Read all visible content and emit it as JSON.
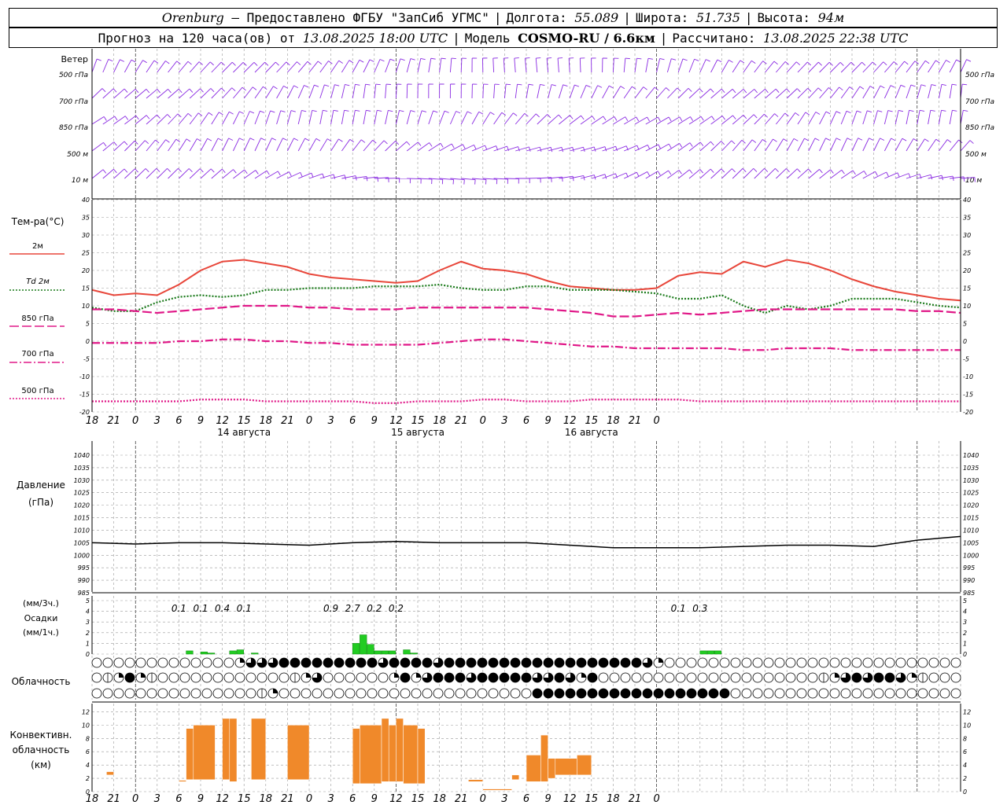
{
  "header": {
    "city": "Orenburg",
    "provider": "— Предоставлено ФГБУ \"ЗапСиб УГМС\"",
    "lon_label": "Долгота:",
    "lon_value": "55.089",
    "lat_label": "Широта:",
    "lat_value": "51.735",
    "alt_label": "Высота:",
    "alt_value": "94м",
    "forecast_label": "Прогноз на 120 часа(ов) от",
    "forecast_time": "13.08.2025 18:00 UTC",
    "model_label": "Модель",
    "model_value": "COSMO-RU / 6.6км",
    "calc_label": "Рассчитано:",
    "calc_time": "13.08.2025 22:38 UTC"
  },
  "labels": {
    "wind": "Ветер",
    "wind_levels": [
      "500 гПа",
      "700 гПа",
      "850 гПа",
      "500 м",
      "10  м"
    ],
    "temp": "Тем-ра(°C)",
    "temp_2m": "2м",
    "td_2m": "Td  2м",
    "t850": "850 гПа",
    "t700": "700 гПа",
    "t500": "500 гПа",
    "pressure": [
      "Давление",
      "(гПа)"
    ],
    "precip": [
      "(мм/3ч.)",
      "Осадки",
      "(мм/1ч.)"
    ],
    "clouds": "Облачность",
    "conv": [
      "Конвективн.",
      "облачность",
      "(км)"
    ]
  },
  "colors": {
    "wind": "#8a2be2",
    "t2m": "#e8463a",
    "td2m": "#1a7a1a",
    "t850": "#e01888",
    "t700": "#e01888",
    "t500": "#e01888",
    "pressure": "#000000",
    "precip": "#22cc22",
    "conv": "#f0892a",
    "grid": "#999999"
  },
  "chart_data": [
    {
      "type": "line",
      "title": "Тем-ра(°C)",
      "x_ticks": [
        "18",
        "21",
        "0",
        "3",
        "6",
        "9",
        "12",
        "15",
        "18",
        "21",
        "0",
        "3",
        "6",
        "9",
        "12",
        "15",
        "18",
        "21",
        "0",
        "3",
        "6",
        "9",
        "12",
        "15",
        "18",
        "21",
        "0"
      ],
      "date_labels": [
        "14 августа",
        "15 августа",
        "16 августа"
      ],
      "ylim": [
        -20,
        40
      ],
      "yticks": [
        -20,
        -15,
        -10,
        -5,
        0,
        5,
        10,
        15,
        20,
        25,
        30,
        35,
        40
      ],
      "x_hours": [
        0,
        3,
        6,
        9,
        12,
        15,
        18,
        21,
        24,
        27,
        30,
        33,
        36,
        39,
        42,
        45,
        48,
        51,
        54,
        57,
        60,
        63,
        66,
        69,
        72,
        75,
        78,
        81
      ],
      "series": [
        {
          "name": "2м",
          "style": "solid",
          "values": [
            14.5,
            13,
            13.5,
            13,
            16,
            20,
            22.5,
            23,
            22,
            21,
            19,
            18,
            17.5,
            17,
            16.5,
            17,
            20,
            22.5,
            20.5,
            20,
            19,
            17,
            15.5,
            15,
            14.5,
            14.5,
            15,
            18.5
          ]
        },
        {
          "name": "Td 2м",
          "style": "dotted",
          "values": [
            9.5,
            8.5,
            8.5,
            11,
            12.5,
            13,
            12.5,
            13,
            14.5,
            14.5,
            15,
            15,
            15,
            15.5,
            15.5,
            15.5,
            16,
            15,
            14.5,
            14.5,
            15.5,
            15.5,
            14.5,
            14.5,
            14.5,
            14,
            13.5,
            12
          ]
        },
        {
          "name": "850 гПа",
          "style": "dashed",
          "values": [
            9,
            9,
            8.5,
            8,
            8.5,
            9,
            9.5,
            10,
            10,
            10,
            9.5,
            9.5,
            9,
            9,
            9,
            9.5,
            9.5,
            9.5,
            9.5,
            9.5,
            9.5,
            9,
            8.5,
            8,
            7,
            7,
            7.5,
            8
          ]
        },
        {
          "name": "700 гПа",
          "style": "dashdot",
          "values": [
            -0.5,
            -0.5,
            -0.5,
            -0.5,
            0,
            0,
            0.5,
            0.5,
            0,
            0,
            -0.5,
            -0.5,
            -1,
            -1,
            -1,
            -1,
            -0.5,
            0,
            0.5,
            0.5,
            0,
            -0.5,
            -1,
            -1.5,
            -1.5,
            -2,
            -2,
            -2
          ]
        },
        {
          "name": "500 гПа",
          "style": "dotted",
          "values": [
            -17,
            -17,
            -17,
            -17,
            -17,
            -16.5,
            -16.5,
            -16.5,
            -17,
            -17,
            -17,
            -17,
            -17,
            -17.5,
            -17.5,
            -17,
            -17,
            -17,
            -16.5,
            -16.5,
            -17,
            -17,
            -17,
            -16.5,
            -16.5,
            -16.5,
            -16.5,
            -16.5
          ]
        }
      ],
      "series_tail": {
        "x_hours": [
          84,
          87,
          90,
          93,
          96,
          99,
          102,
          105,
          108,
          111,
          114,
          117,
          120
        ],
        "2м": [
          19.5,
          19,
          22.5,
          21,
          23,
          22,
          20,
          17.5,
          15.5,
          14,
          13,
          12,
          11.5
        ],
        "Td 2м": [
          12,
          13,
          10,
          8,
          10,
          9,
          10,
          12,
          12,
          12,
          11,
          10,
          9.5
        ],
        "850 гПа": [
          7.5,
          8,
          8.5,
          9,
          9,
          9,
          9,
          9,
          9,
          9,
          8.5,
          8.5,
          8
        ],
        "700 гПа": [
          -2,
          -2,
          -2.5,
          -2.5,
          -2,
          -2,
          -2,
          -2.5,
          -2.5,
          -2.5,
          -2.5,
          -2.5,
          -2.5
        ],
        "500 гПа": [
          -17,
          -17,
          -17,
          -17,
          -17,
          -17,
          -17,
          -17,
          -17,
          -17,
          -17,
          -17,
          -17
        ]
      }
    },
    {
      "type": "line",
      "title": "Давление (гПа)",
      "ylim": [
        985,
        1040
      ],
      "yticks": [
        985,
        990,
        995,
        1000,
        1005,
        1010,
        1015,
        1020,
        1025,
        1030,
        1035,
        1040
      ],
      "x_hours": [
        0,
        6,
        12,
        18,
        24,
        30,
        36,
        42,
        48,
        54,
        60,
        66,
        72,
        78,
        84,
        90,
        96,
        102,
        108,
        114,
        120
      ],
      "values": [
        1005,
        1004.5,
        1005,
        1005,
        1004.5,
        1004,
        1005,
        1005.5,
        1005,
        1005,
        1005,
        1004,
        1003,
        1003,
        1003,
        1003.5,
        1004,
        1004,
        1003.5,
        1006,
        1007.5
      ]
    },
    {
      "type": "bar",
      "title": "Осадки",
      "ylim": [
        0,
        5
      ],
      "yticks": [
        0,
        1,
        2,
        3,
        4,
        5
      ],
      "bars_hourly": [
        {
          "hour": 13,
          "value": 0.3
        },
        {
          "hour": 15,
          "value": 0.2
        },
        {
          "hour": 16,
          "value": 0.1
        },
        {
          "hour": 19,
          "value": 0.3
        },
        {
          "hour": 20,
          "value": 0.4
        },
        {
          "hour": 22,
          "value": 0.1
        },
        {
          "hour": 36,
          "value": 1.0
        },
        {
          "hour": 37,
          "value": 1.8
        },
        {
          "hour": 38,
          "value": 0.9
        },
        {
          "hour": 39,
          "value": 0.3
        },
        {
          "hour": 40,
          "value": 0.3
        },
        {
          "hour": 41,
          "value": 0.3
        },
        {
          "hour": 43,
          "value": 0.4
        },
        {
          "hour": 44,
          "value": 0.1
        },
        {
          "hour": 84,
          "value": 0.3
        },
        {
          "hour": 85,
          "value": 0.3
        },
        {
          "hour": 86,
          "value": 0.3
        }
      ],
      "sums_3h": [
        {
          "hour": 12,
          "label": "0.1"
        },
        {
          "hour": 15,
          "label": "0.1"
        },
        {
          "hour": 18,
          "label": "0.4"
        },
        {
          "hour": 21,
          "label": "0.1"
        },
        {
          "hour": 33,
          "label": "0.9"
        },
        {
          "hour": 36,
          "label": "2.7"
        },
        {
          "hour": 39,
          "label": "0.2"
        },
        {
          "hour": 42,
          "label": "0.2"
        },
        {
          "hour": 81,
          "label": "0.1"
        },
        {
          "hour": 84,
          "label": "0.3"
        }
      ]
    },
    {
      "type": "bar",
      "title": "Конвективн. облачность (км)",
      "ylim": [
        0,
        13
      ],
      "yticks": [
        0,
        2,
        4,
        6,
        8,
        10,
        12
      ],
      "bars": [
        {
          "from": 2,
          "to": 3,
          "base": 2.5,
          "top": 3
        },
        {
          "from": 12,
          "to": 13,
          "base": 1.5,
          "top": 1.7
        },
        {
          "from": 13,
          "to": 14,
          "base": 1.8,
          "top": 9.5
        },
        {
          "from": 14,
          "to": 17,
          "base": 1.8,
          "top": 10
        },
        {
          "from": 18,
          "to": 19,
          "base": 1.8,
          "top": 11
        },
        {
          "from": 19,
          "to": 20,
          "base": 1.5,
          "top": 11
        },
        {
          "from": 22,
          "to": 24,
          "base": 1.8,
          "top": 11
        },
        {
          "from": 27,
          "to": 30,
          "base": 1.8,
          "top": 10
        },
        {
          "from": 36,
          "to": 37,
          "base": 1.2,
          "top": 9.5
        },
        {
          "from": 37,
          "to": 40,
          "base": 1.2,
          "top": 10
        },
        {
          "from": 40,
          "to": 41,
          "base": 1.5,
          "top": 11
        },
        {
          "from": 41,
          "to": 42,
          "base": 1.5,
          "top": 10
        },
        {
          "from": 42,
          "to": 43,
          "base": 1.5,
          "top": 11
        },
        {
          "from": 43,
          "to": 45,
          "base": 1.2,
          "top": 10
        },
        {
          "from": 45,
          "to": 46,
          "base": 1.2,
          "top": 9.5
        },
        {
          "from": 52,
          "to": 54,
          "base": 1.5,
          "top": 1.8
        },
        {
          "from": 54,
          "to": 58,
          "base": 0.2,
          "top": 0.4
        },
        {
          "from": 58,
          "to": 59,
          "base": 1.8,
          "top": 2.5
        },
        {
          "from": 60,
          "to": 62,
          "base": 1.5,
          "top": 5.5
        },
        {
          "from": 62,
          "to": 63,
          "base": 1.5,
          "top": 8.5
        },
        {
          "from": 63,
          "to": 64,
          "base": 2,
          "top": 5
        },
        {
          "from": 64,
          "to": 67,
          "base": 2.5,
          "top": 5
        },
        {
          "from": 67,
          "to": 69,
          "base": 2.5,
          "top": 5.5
        }
      ]
    }
  ],
  "clouds_rows": {
    "row1": "0000000000000233344444444434444344444444444444444432000000000000000000000000000",
    "row2": "0124210000000000001230000002423444344444334324000000000000000000001234344321000",
    "row3": "0000000000000001200000000000000000000000444444444444444444000000000000000000000"
  }
}
